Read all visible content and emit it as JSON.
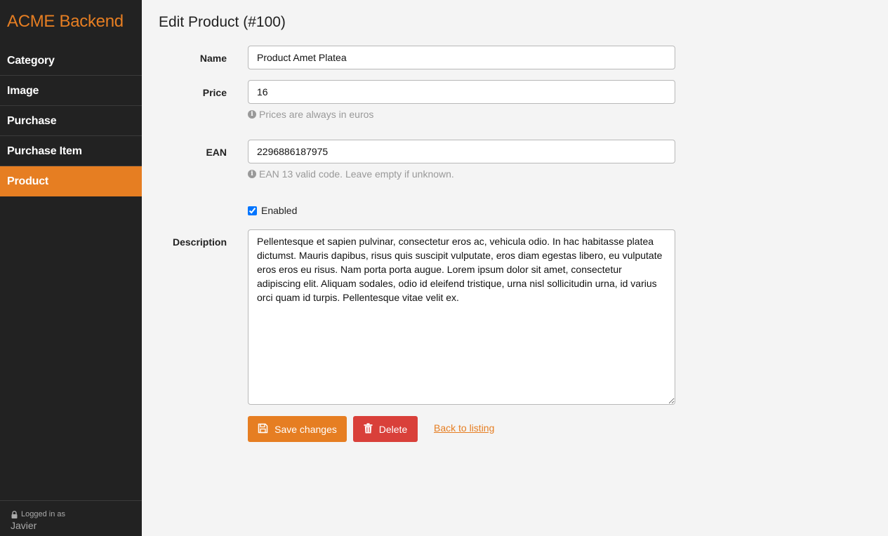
{
  "sidebar": {
    "brand": "ACME Backend",
    "items": [
      {
        "label": "Category",
        "active": false
      },
      {
        "label": "Image",
        "active": false
      },
      {
        "label": "Purchase",
        "active": false
      },
      {
        "label": "Purchase Item",
        "active": false
      },
      {
        "label": "Product",
        "active": true
      }
    ],
    "footer": {
      "logged_in_label": "Logged in as",
      "user": "Javier"
    }
  },
  "main": {
    "title": "Edit Product (#100)",
    "form": {
      "name_label": "Name",
      "name_value": "Product Amet Platea",
      "price_label": "Price",
      "price_value": "16",
      "price_help": "Prices are always in euros",
      "ean_label": "EAN",
      "ean_value": "2296886187975",
      "ean_help": "EAN 13 valid code. Leave empty if unknown.",
      "enabled_label": "Enabled",
      "enabled_checked": true,
      "description_label": "Description",
      "description_value": "Pellentesque et sapien pulvinar, consectetur eros ac, vehicula odio. In hac habitasse platea dictumst. Mauris dapibus, risus quis suscipit vulputate, eros diam egestas libero, eu vulputate eros eros eu risus. Nam porta porta augue. Lorem ipsum dolor sit amet, consectetur adipiscing elit. Aliquam sodales, odio id eleifend tristique, urna nisl sollicitudin urna, id varius orci quam id turpis. Pellentesque vitae velit ex."
    },
    "actions": {
      "save_label": "Save changes",
      "delete_label": "Delete",
      "back_label": "Back to listing"
    }
  },
  "colors": {
    "accent": "#e67e22",
    "danger": "#d9403a",
    "sidebar_bg": "#222222",
    "page_bg": "#f4f4f4"
  },
  "icons": {
    "save": "floppy-disk-icon",
    "delete": "trash-icon",
    "info": "info-circle-icon",
    "lock": "lock-icon"
  }
}
